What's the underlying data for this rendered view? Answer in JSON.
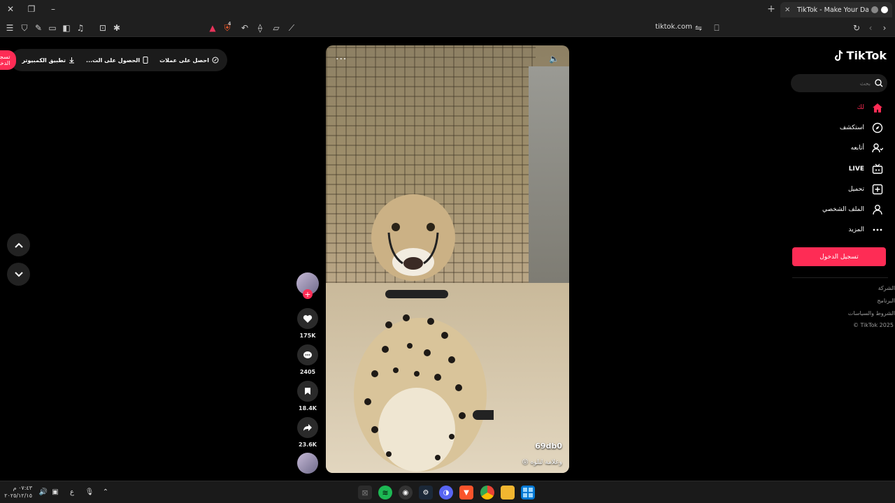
{
  "browser": {
    "tab_title": "TikTok - Make Your Day",
    "url": "tiktok.com",
    "shield_badge": "4"
  },
  "header": {
    "get_coins": "احصل على عملات",
    "get_app": "الحصول على الت...",
    "pc_app": "تطبيق الكمبيوتر",
    "login": "تسجيل الدخول"
  },
  "video": {
    "author": "69db0",
    "caption": "وعلامة لبلوه 😝"
  },
  "actions": {
    "likes": "175K",
    "comments": "2405",
    "saves": "18.4K",
    "shares": "23.6K"
  },
  "sidebar": {
    "logo": "TikTok",
    "search_placeholder": "بحث",
    "items": [
      {
        "label": "لك",
        "icon": "home-icon"
      },
      {
        "label": "استكشف",
        "icon": "compass-icon"
      },
      {
        "label": "أتابعه",
        "icon": "following-icon"
      },
      {
        "label": "LIVE",
        "icon": "live-icon"
      },
      {
        "label": "تحميل",
        "icon": "upload-icon"
      },
      {
        "label": "الملف الشخصي",
        "icon": "profile-icon"
      },
      {
        "label": "المزيد",
        "icon": "more-icon"
      }
    ],
    "login": "تسجيل الدخول",
    "footer": [
      "الشركة",
      "البرنامج",
      "الشروط والسياسات",
      "© TikTok 2025"
    ]
  },
  "taskbar": {
    "time": "٠٧:٤٣ م",
    "date": "٢٠٢٥/١٢/١٥",
    "lang": "ع"
  },
  "colors": {
    "accent": "#fe2c55",
    "bg": "#000000"
  }
}
